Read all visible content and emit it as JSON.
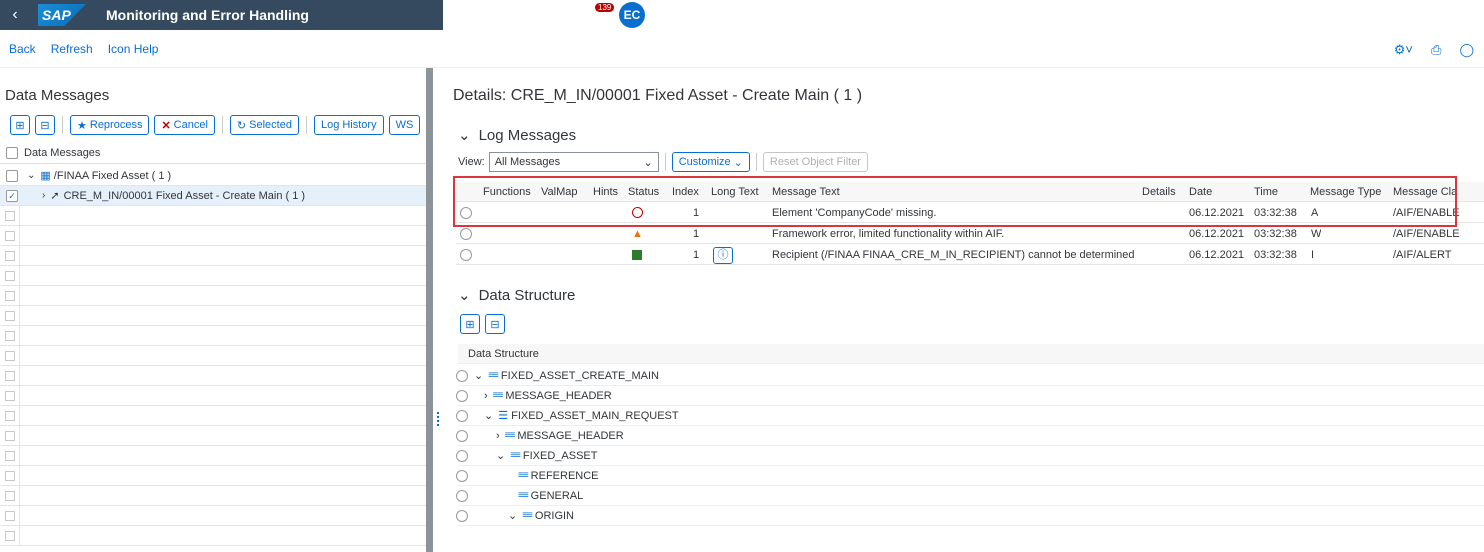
{
  "shell": {
    "back_icon": "chevron-left-icon",
    "logo": "SAP",
    "title": "Monitoring and Error Handling",
    "notification_count": "139",
    "avatar_initials": "EC"
  },
  "toolbar": {
    "back": "Back",
    "refresh": "Refresh",
    "icon_help": "Icon Help"
  },
  "left": {
    "title": "Data Messages",
    "buttons": {
      "reprocess": "Reprocess",
      "cancel": "Cancel",
      "selected": "Selected",
      "log_history": "Log History",
      "ws": "WS"
    },
    "header": "Data Messages",
    "tree": [
      {
        "label": "/FINAA Fixed Asset ( 1 )"
      },
      {
        "label": "CRE_M_IN/00001 Fixed Asset - Create Main ( 1 )"
      }
    ]
  },
  "right": {
    "title": "Details:  CRE_M_IN/00001 Fixed Asset - Create Main ( 1 )",
    "log_section": "Log Messages",
    "view_label": "View:",
    "view_value": "All Messages",
    "customize": "Customize",
    "reset_filter": "Reset Object Filter",
    "columns": {
      "functions": "Functions",
      "valmap": "ValMap",
      "hints": "Hints",
      "status": "Status",
      "index": "Index",
      "long_text": "Long Text",
      "message_text": "Message Text",
      "details": "Details",
      "date": "Date",
      "time": "Time",
      "message_type": "Message Type",
      "message_class": "Message Cla"
    },
    "rows": [
      {
        "status": "error",
        "index": "1",
        "text": "Element 'CompanyCode' missing.",
        "date": "06.12.2021",
        "time": "03:32:38",
        "type": "A",
        "class": "/AIF/ENABLE"
      },
      {
        "status": "warning",
        "index": "1",
        "text": "Framework error, limited functionality within AIF.",
        "date": "06.12.2021",
        "time": "03:32:38",
        "type": "W",
        "class": "/AIF/ENABLE"
      },
      {
        "status": "success",
        "index": "1",
        "text": "Recipient (/FINAA FINAA_CRE_M_IN_RECIPIENT) cannot be determined",
        "date": "06.12.2021",
        "time": "03:32:38",
        "type": "I",
        "class": "/AIF/ALERT"
      }
    ],
    "ds_section": "Data Structure",
    "ds_header": "Data Structure",
    "ds_nodes": [
      "FIXED_ASSET_CREATE_MAIN",
      "MESSAGE_HEADER",
      "FIXED_ASSET_MAIN_REQUEST",
      "MESSAGE_HEADER",
      "FIXED_ASSET",
      "REFERENCE",
      "GENERAL",
      "ORIGIN"
    ]
  },
  "colors": {
    "shell": "#354a5f",
    "accent": "#0a6ed1",
    "error": "#bb0000",
    "warning": "#e9730c",
    "success": "#2b7d2b",
    "highlight": "#d9373d"
  }
}
